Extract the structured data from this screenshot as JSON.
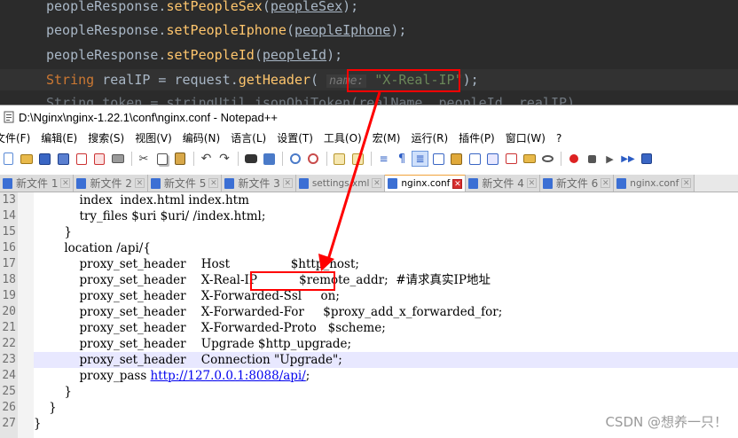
{
  "ide": {
    "lines": [
      {
        "obj": "peopleResponse.",
        "method": "setPeopleSex",
        "open": "(",
        "param": "peopleSex",
        "close": ");"
      },
      {
        "obj": "peopleResponse.",
        "method": "setPeopleIphone",
        "open": "(",
        "param": "peopleIphone",
        "close": ");"
      },
      {
        "obj": "peopleResponse.",
        "method": "setPeopleId",
        "open": "(",
        "param": "peopleId",
        "close": ");"
      }
    ],
    "header_line": {
      "type": "String",
      "var": " realIP = request.",
      "method": "getHeader",
      "open": "( ",
      "hint": "name:",
      "arg": " \"X-Real-IP\"",
      "close": ");"
    },
    "ghost_line": "String token = stringUtil.jsonObjToken(realName, peopleId, realIP)"
  },
  "npp": {
    "title": "D:\\Nginx\\nginx-1.22.1\\conf\\nginx.conf - Notepad++",
    "menu": [
      "文件(F)",
      "编辑(E)",
      "搜索(S)",
      "视图(V)",
      "编码(N)",
      "语言(L)",
      "设置(T)",
      "工具(O)",
      "宏(M)",
      "运行(R)",
      "插件(P)",
      "窗口(W)",
      "?"
    ],
    "tabs": [
      {
        "label": "新文件 1",
        "active": false
      },
      {
        "label": "新文件 2",
        "active": false
      },
      {
        "label": "新文件 5",
        "active": false
      },
      {
        "label": "新文件 3",
        "active": false
      },
      {
        "label": "settings.xml",
        "active": false
      },
      {
        "label": "nginx.conf",
        "active": true
      },
      {
        "label": "新文件 4",
        "active": false
      },
      {
        "label": "新文件 6",
        "active": false
      },
      {
        "label": "nginx.conf",
        "active": false
      }
    ],
    "toolbar_icons": [
      "new-file-icon",
      "open-file-icon",
      "save-icon",
      "save-all-icon",
      "close-icon",
      "close-all-icon",
      "print-icon",
      "cut-icon",
      "copy-icon",
      "paste-icon",
      "undo-icon",
      "redo-icon",
      "find-icon",
      "replace-icon",
      "zoom-in-icon",
      "zoom-out-icon",
      "sync-v-icon",
      "sync-h-icon",
      "word-wrap-icon",
      "show-all-chars-icon",
      "indent-guide-icon",
      "udl-icon",
      "doc-map-icon",
      "function-list-icon",
      "folder-workspace-icon",
      "monitor-icon",
      "record-macro-icon",
      "stop-macro-icon",
      "play-macro-icon",
      "run-macro-multiple-icon",
      "save-macro-icon"
    ],
    "editor": {
      "lines": [
        {
          "n": "13",
          "text": "            index  index.html index.htm"
        },
        {
          "n": "14",
          "text": "            try_files $uri $uri/ /index.html;"
        },
        {
          "n": "15",
          "text": "        }"
        },
        {
          "n": "16",
          "text": "        location /api/{"
        },
        {
          "n": "17",
          "text": "            proxy_set_header    Host                $http_host;"
        },
        {
          "n": "18",
          "text": "            proxy_set_header    X-Real-IP           $remote_addr;  #请求真实IP地址"
        },
        {
          "n": "19",
          "text": "            proxy_set_header    X-Forwarded-Ssl     on;"
        },
        {
          "n": "20",
          "text": "            proxy_set_header    X-Forwarded-For     $proxy_add_x_forwarded_for;"
        },
        {
          "n": "21",
          "text": "            proxy_set_header    X-Forwarded-Proto   $scheme;"
        },
        {
          "n": "22",
          "text": "            proxy_set_header    Upgrade $http_upgrade;"
        },
        {
          "n": "23",
          "text": "            proxy_set_header    Connection \"Upgrade\";"
        },
        {
          "n": "24",
          "pre": "            proxy_pass ",
          "url": "http://127.0.0.1:8088/api/",
          "post": ";"
        },
        {
          "n": "25",
          "text": "        }"
        },
        {
          "n": "26",
          "text": "    }"
        },
        {
          "n": "27",
          "text": "}"
        }
      ]
    }
  },
  "watermark": "CSDN @想养一只！",
  "colors": {
    "annotation": "#ff0000",
    "active_tab_close": "#d62d2d",
    "current_line": "#e8e8ff"
  }
}
